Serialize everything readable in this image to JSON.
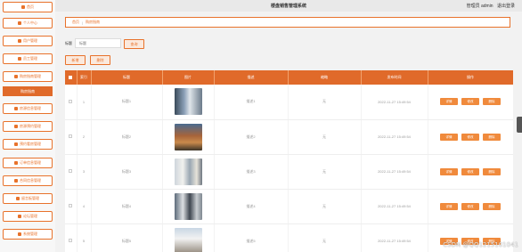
{
  "app": {
    "title": "楼盘销售管理系统",
    "admin_label": "管理员 admin",
    "logout_label": "退出登录"
  },
  "sidebar": {
    "items": [
      {
        "label": "首页",
        "icon": "home-icon"
      },
      {
        "label": "个人中心",
        "icon": "user-icon"
      },
      {
        "label": "用户管理",
        "icon": "grid-icon"
      },
      {
        "label": "员工管理",
        "icon": "id-card-icon"
      },
      {
        "label": "购房指南管理",
        "icon": "grid-icon"
      },
      {
        "label": "房源信息管理",
        "icon": "grid-icon"
      },
      {
        "label": "房源预约管理",
        "icon": "grid-icon"
      },
      {
        "label": "预约看房管理",
        "icon": "list-icon"
      },
      {
        "label": "订单信息管理",
        "icon": "chat-icon"
      },
      {
        "label": "合同信息管理",
        "icon": "house-icon"
      },
      {
        "label": "留言板管理",
        "icon": "grid-icon"
      },
      {
        "label": "论坛管理",
        "icon": "grid-icon"
      },
      {
        "label": "系统管理",
        "icon": "grid-icon"
      }
    ],
    "sub_item": "购房指南"
  },
  "breadcrumb": {
    "home": "首页",
    "current": "购房指南"
  },
  "search": {
    "label": "标题",
    "placeholder": "标题",
    "button": "查询"
  },
  "toolbar": {
    "add": "新增",
    "delete": "删除"
  },
  "table": {
    "headers": [
      "索引",
      "标题",
      "图片",
      "描述",
      "缩略",
      "发布时间",
      "操作"
    ],
    "actions": [
      "详情",
      "修改",
      "删除"
    ],
    "rows": [
      {
        "index": "1",
        "title": "标题1",
        "desc": "描述1",
        "thumb": "无",
        "time": "2022-11-27 15:49:54"
      },
      {
        "index": "2",
        "title": "标题2",
        "desc": "描述2",
        "thumb": "无",
        "time": "2022-11-27 15:49:54"
      },
      {
        "index": "3",
        "title": "标题3",
        "desc": "描述3",
        "thumb": "无",
        "time": "2022-11-27 15:49:54"
      },
      {
        "index": "4",
        "title": "标题4",
        "desc": "描述4",
        "thumb": "无",
        "time": "2022-11-27 15:49:54"
      },
      {
        "index": "5",
        "title": "标题5",
        "desc": "描述5",
        "thumb": "无",
        "time": "2022-11-27 15:49:54"
      }
    ]
  },
  "colors": {
    "accent": "#e06a2a",
    "button": "#f08a3c"
  },
  "watermark": "CSDN @QQ1215101041"
}
